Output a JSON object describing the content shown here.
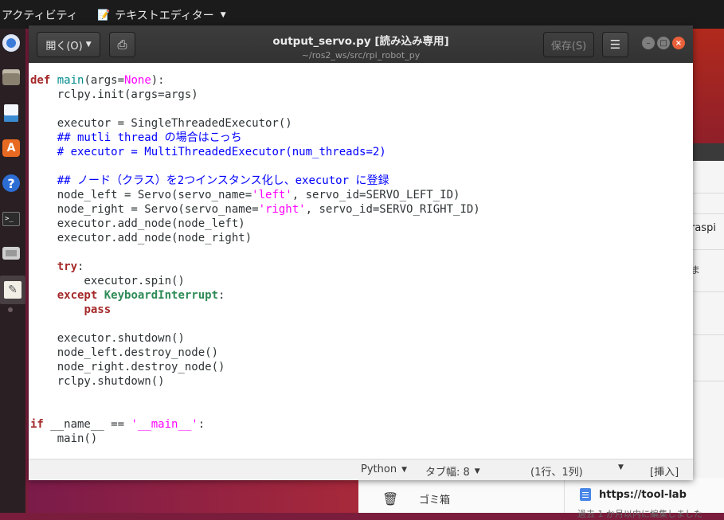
{
  "topbar": {
    "activities": "アクティビティ",
    "app_menu": "テキストエディター"
  },
  "dock": {
    "items": [
      "chrome-icon",
      "files-icon",
      "writer-icon",
      "software-icon",
      "help-icon",
      "terminal-icon",
      "camera-icon",
      "gedit-icon"
    ]
  },
  "window": {
    "title": "output_servo.py [読み込み専用]",
    "subtitle": "~/ros2_ws/src/rpi_robot_py",
    "open_label": "開く(O)",
    "save_label": "保存(S)"
  },
  "code_lines": [
    "def main(args=None):",
    "    rclpy.init(args=args)",
    "",
    "    executor = SingleThreadedExecutor()",
    "    ## mutli thread の場合はこっち",
    "    # executor = MultiThreadedExecutor(num_threads=2)",
    "",
    "    ## ノード（クラス）を2つインスタンス化し、executor に登録",
    "    node_left = Servo(servo_name='left', servo_id=SERVO_LEFT_ID)",
    "    node_right = Servo(servo_name='right', servo_id=SERVO_RIGHT_ID)",
    "    executor.add_node(node_left)",
    "    executor.add_node(node_right)",
    "",
    "    try:",
    "        executor.spin()",
    "    except KeyboardInterrupt:",
    "        pass",
    "",
    "    executor.shutdown()",
    "    node_left.destroy_node()",
    "    node_right.destroy_node()",
    "    rclpy.shutdown()",
    "",
    "",
    "if __name__ == '__main__':",
    "    main()"
  ],
  "statusbar": {
    "language": "Python",
    "tab_width": "タブ幅: 8",
    "position": "(1行、1列)",
    "mode": "[挿入]"
  },
  "background": {
    "browser_text": "raspi",
    "trash_label": "ゴミ箱",
    "doc_url": "https://tool-lab",
    "edited_text": "過去 1 か月以内に編集しました"
  }
}
